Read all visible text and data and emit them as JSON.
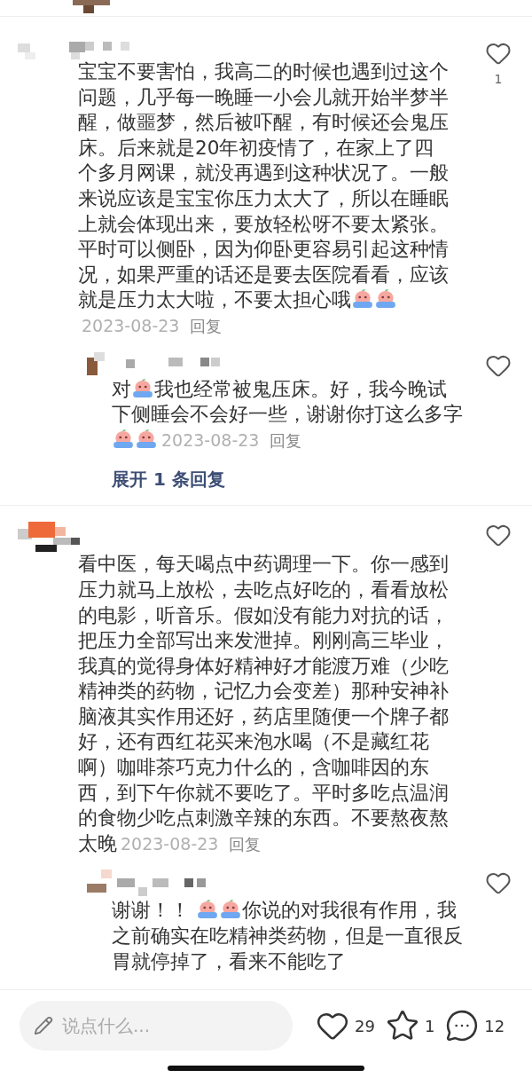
{
  "comments": [
    {
      "body": [
        {
          "kind": "text",
          "text": "宝宝不要害怕，我高二的时候也遇到过这个问题，几乎每一晚睡一小会儿就开始半梦半醒，做噩梦，然后被吓醒，有时候还会鬼压床。后来就是20年初疫情了，在家上了四个多月网课，就没再遇到这种状况了。一般来说应该是宝宝你压力太大了，所以在睡眠上就会体现出来，要放轻松呀不要太紧张。平时可以侧卧，因为仰卧更容易引起这种情况，如果严重的话还是要去医院看看，应该就是压力太大啦，不要太担心哦"
        },
        {
          "kind": "emoji"
        },
        {
          "kind": "emoji"
        }
      ],
      "date": "2023-08-23",
      "reply_label": "回复",
      "like_count": "1",
      "replies": [
        {
          "body": [
            {
              "kind": "text",
              "text": "对"
            },
            {
              "kind": "emoji"
            },
            {
              "kind": "text",
              "text": "我也经常被鬼压床。好，我今晚试下侧睡会不会好一些，谢谢你打这么多字"
            },
            {
              "kind": "emoji"
            },
            {
              "kind": "emoji"
            }
          ],
          "date": "2023-08-23",
          "reply_label": "回复"
        }
      ],
      "expand_label": "展开 1 条回复"
    },
    {
      "body": [
        {
          "kind": "text",
          "text": "看中医，每天喝点中药调理一下。你一感到压力就马上放松，去吃点好吃的，看看放松的电影，听音乐。假如没有能力对抗的话，把压力全部写出来发泄掉。刚刚高三毕业，我真的觉得身体好精神好才能渡万难（少吃精神类的药物，记忆力会变差）那种安神补脑液其实作用还好，药店里随便一个牌子都好，还有西红花买来泡水喝（不是藏红花啊）咖啡茶巧克力什么的，含咖啡因的东西，到下午你就不要吃了。平时多吃点温润的食物少吃点刺激辛辣的东西。不要熬夜熬太晚"
        }
      ],
      "date": "2023-08-23",
      "reply_label": "回复",
      "replies": [
        {
          "body": [
            {
              "kind": "text",
              "text": "谢谢！！ "
            },
            {
              "kind": "emoji"
            },
            {
              "kind": "emoji"
            },
            {
              "kind": "text",
              "text": "你说的对我很有作用，我之前确实在吃精神类药物，但是一直很反胃就停掉了，看来不能吃了"
            }
          ]
        }
      ]
    }
  ],
  "bottom_bar": {
    "input": {
      "placeholder": "说点什么..."
    },
    "likes": "29",
    "stars": "1",
    "comments": "12"
  }
}
